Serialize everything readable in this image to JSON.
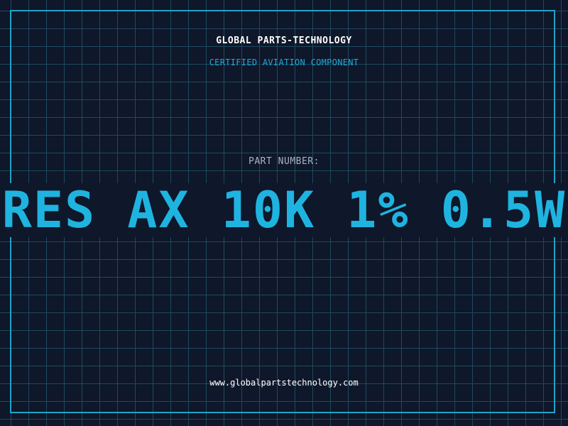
{
  "header": {
    "company_name": "GLOBAL PARTS-TECHNOLOGY",
    "subtitle": "CERTIFIED AVIATION COMPONENT"
  },
  "part": {
    "label": "PART NUMBER:",
    "number": "RES AX 10K 1% 0.5W"
  },
  "footer": {
    "website": "www.globalpartstechnology.com"
  },
  "colors": {
    "background": "#0f172a",
    "grid": "#1d4a5e",
    "accent": "#1fb4e0",
    "border": "#1fa3c7",
    "label": "#a7b4c6"
  }
}
